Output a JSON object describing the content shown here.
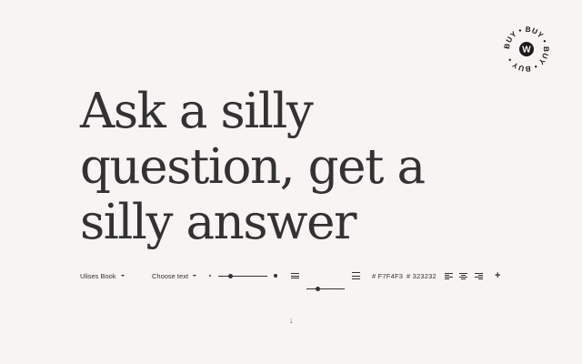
{
  "badge": {
    "text": "BUY • BUY • BUY • BUY • ",
    "logo_letter": "W"
  },
  "headline": {
    "line1": "Ask a silly",
    "line2": "question, get a",
    "line3": "silly answer"
  },
  "toolbar": {
    "font_selector": "Ulises Book",
    "text_selector": "Choose text",
    "size_slider_level": 0.25,
    "leading_slider_level": 0.3,
    "background_color": "# F7F4F3",
    "text_color": "# 323232",
    "add_label": "+"
  },
  "colors": {
    "background": "#F7F4F3",
    "text": "#323232"
  },
  "scroll": {
    "arrow": "↓"
  }
}
